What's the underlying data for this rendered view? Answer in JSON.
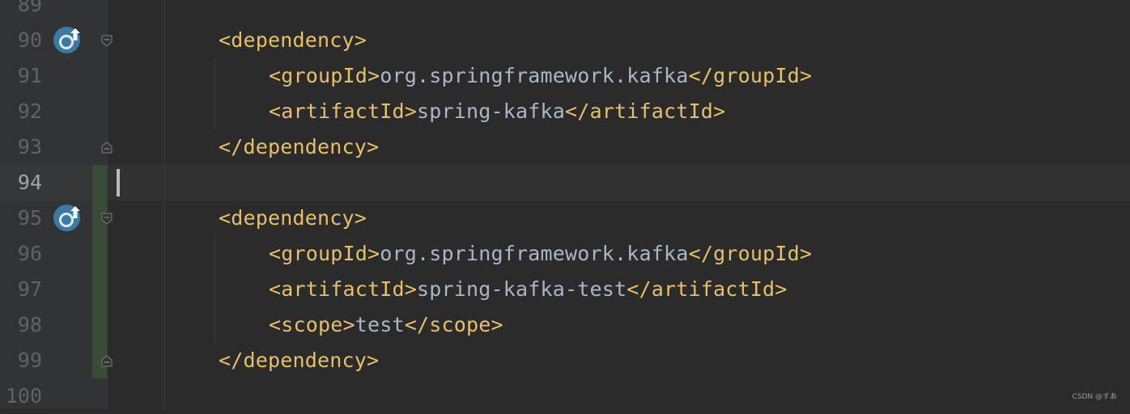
{
  "editor": {
    "lines": [
      {
        "number": "89",
        "indent": 0,
        "tokens": []
      },
      {
        "number": "90",
        "indent": 2,
        "tokens": [
          {
            "t": "tag",
            "v": "<dependency>"
          }
        ]
      },
      {
        "number": "91",
        "indent": 3,
        "tokens": [
          {
            "t": "tag",
            "v": "<groupId>"
          },
          {
            "t": "text",
            "v": "org.springframework.kafka"
          },
          {
            "t": "tag",
            "v": "</groupId>"
          }
        ]
      },
      {
        "number": "92",
        "indent": 3,
        "tokens": [
          {
            "t": "tag",
            "v": "<artifactId>"
          },
          {
            "t": "text",
            "v": "spring-kafka"
          },
          {
            "t": "tag",
            "v": "</artifactId>"
          }
        ]
      },
      {
        "number": "93",
        "indent": 2,
        "tokens": [
          {
            "t": "tag",
            "v": "</dependency>"
          }
        ]
      },
      {
        "number": "94",
        "indent": 0,
        "tokens": [],
        "current": true
      },
      {
        "number": "95",
        "indent": 2,
        "tokens": [
          {
            "t": "tag",
            "v": "<dependency>"
          }
        ]
      },
      {
        "number": "96",
        "indent": 3,
        "tokens": [
          {
            "t": "tag",
            "v": "<groupId>"
          },
          {
            "t": "text",
            "v": "org.springframework.kafka"
          },
          {
            "t": "tag",
            "v": "</groupId>"
          }
        ]
      },
      {
        "number": "97",
        "indent": 3,
        "tokens": [
          {
            "t": "tag",
            "v": "<artifactId>"
          },
          {
            "t": "text",
            "v": "spring-kafka-test"
          },
          {
            "t": "tag",
            "v": "</artifactId>"
          }
        ]
      },
      {
        "number": "98",
        "indent": 3,
        "tokens": [
          {
            "t": "tag",
            "v": "<scope>"
          },
          {
            "t": "text",
            "v": "test"
          },
          {
            "t": "tag",
            "v": "</scope>"
          }
        ]
      },
      {
        "number": "99",
        "indent": 2,
        "tokens": [
          {
            "t": "tag",
            "v": "</dependency>"
          }
        ]
      },
      {
        "number": "100",
        "indent": 0,
        "tokens": []
      }
    ],
    "gutter_icons": [
      {
        "line": "90",
        "icon": "maven-dependency-update-icon"
      },
      {
        "line": "95",
        "icon": "maven-dependency-update-icon"
      }
    ],
    "fold_markers": [
      {
        "line": "90",
        "kind": "open"
      },
      {
        "line": "93",
        "kind": "close"
      },
      {
        "line": "95",
        "kind": "open"
      },
      {
        "line": "99",
        "kind": "close"
      }
    ],
    "colors": {
      "background": "#2b2b2b",
      "gutter": "#313335",
      "tag": "#e8bf6a",
      "text": "#a9b7c6",
      "line_number": "#606366",
      "vcs_added": "#384c38",
      "badge": "#3d7aa1"
    }
  },
  "watermark": "CSDN @すあ"
}
